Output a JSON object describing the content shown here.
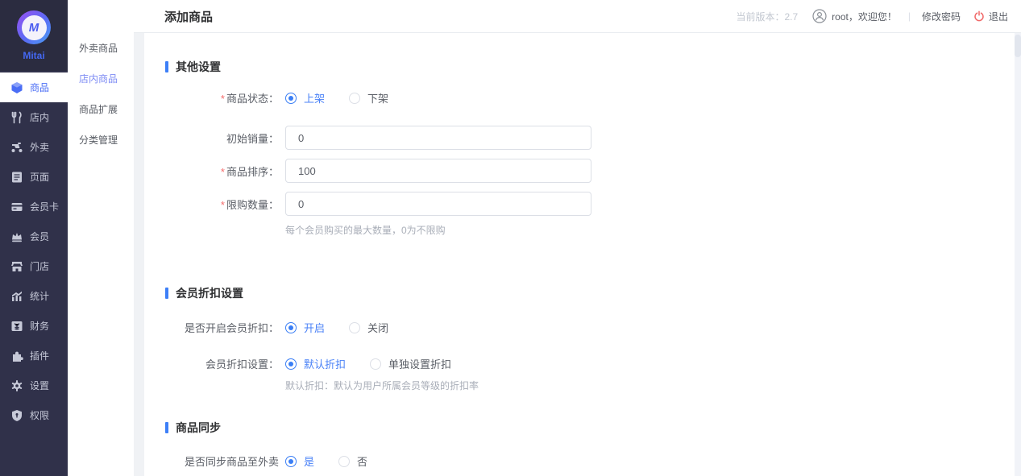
{
  "colors": {
    "accent_blue": "#3a7ef5",
    "link_blue": "#7d8bf4",
    "sidebar_bg": "#30314a",
    "logo_block_bg": "#2b2c40",
    "danger_red": "#f56c6c",
    "page_bg": "#f0f2f5"
  },
  "sidebar": {
    "logo_glyph": "M",
    "logo_text": "Mitai",
    "items": [
      {
        "label": "商品",
        "active": true
      },
      {
        "label": "店内",
        "active": false
      },
      {
        "label": "外卖",
        "active": false
      },
      {
        "label": "页面",
        "active": false
      },
      {
        "label": "会员卡",
        "active": false
      },
      {
        "label": "会员",
        "active": false
      },
      {
        "label": "门店",
        "active": false
      },
      {
        "label": "统计",
        "active": false
      },
      {
        "label": "财务",
        "active": false
      },
      {
        "label": "插件",
        "active": false
      },
      {
        "label": "设置",
        "active": false
      },
      {
        "label": "权限",
        "active": false
      }
    ]
  },
  "submenu": {
    "items": [
      {
        "label": "外卖商品",
        "active": false
      },
      {
        "label": "店内商品",
        "active": true
      },
      {
        "label": "商品扩展",
        "active": false
      },
      {
        "label": "分类管理",
        "active": false
      }
    ]
  },
  "topbar": {
    "title": "添加商品",
    "version": "当前版本：2.7",
    "welcome": "root，欢迎您！",
    "separator": "|",
    "change_password": "修改密码",
    "logout": "退出"
  },
  "form": {
    "sections": [
      {
        "title": "其他设置",
        "rows": [
          {
            "required": "*",
            "label": "商品状态：",
            "type": "radio",
            "options": [
              {
                "label": "上架",
                "selected": true
              },
              {
                "label": "下架",
                "selected": false
              }
            ]
          },
          {
            "label": "初始销量：",
            "type": "input",
            "value": "0"
          },
          {
            "required": "*",
            "label": "商品排序：",
            "type": "input",
            "value": "100"
          },
          {
            "required": "*",
            "label": "限购数量：",
            "type": "input",
            "value": "0",
            "help": "每个会员购买的最大数量，0为不限购"
          }
        ]
      },
      {
        "title": "会员折扣设置",
        "rows": [
          {
            "label": "是否开启会员折扣：",
            "type": "radio",
            "options": [
              {
                "label": "开启",
                "selected": true
              },
              {
                "label": "关闭",
                "selected": false
              }
            ]
          },
          {
            "label": "会员折扣设置：",
            "type": "radio",
            "options": [
              {
                "label": "默认折扣",
                "selected": true
              },
              {
                "label": "单独设置折扣",
                "selected": false
              }
            ],
            "help": "默认折扣：默认为用户所属会员等级的折扣率"
          }
        ]
      },
      {
        "title": "商品同步",
        "rows": [
          {
            "label": "是否同步商品至外卖",
            "type": "radio",
            "options": [
              {
                "label": "是",
                "selected": true
              },
              {
                "label": "否",
                "selected": false
              }
            ]
          }
        ]
      }
    ]
  }
}
